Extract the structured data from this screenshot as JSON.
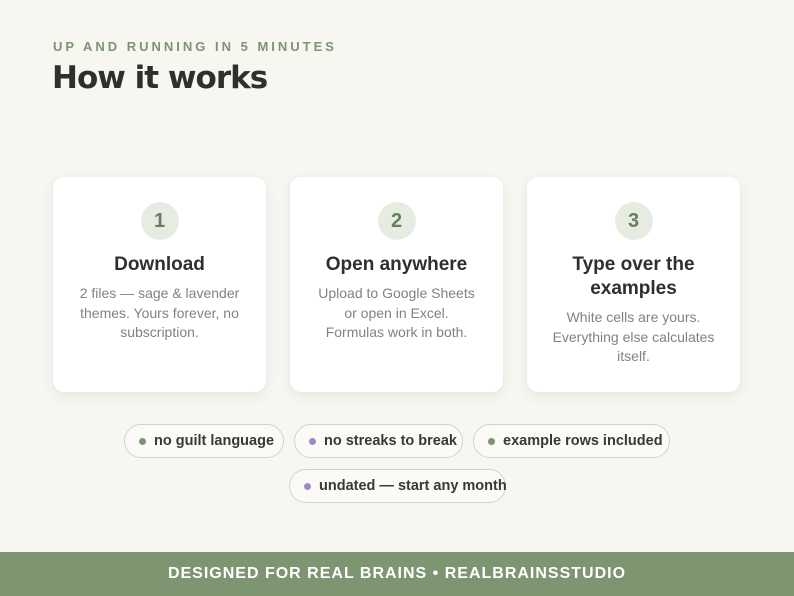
{
  "header": {
    "eyebrow": "UP AND RUNNING IN 5 MINUTES",
    "title": "How it works"
  },
  "steps": [
    {
      "number": "1",
      "title": "Download",
      "description": "2 files — sage & lavender themes. Yours forever, no subscription."
    },
    {
      "number": "2",
      "title": "Open anywhere",
      "description": "Upload to Google Sheets or open in Excel. Formulas work in both."
    },
    {
      "number": "3",
      "title": "Type over the examples",
      "description": "White cells are yours. Everything else calculates itself."
    }
  ],
  "features": [
    {
      "label": "no guilt language",
      "dot_color": "#7c9474"
    },
    {
      "label": "no streaks to break",
      "dot_color": "#9a8cc4"
    },
    {
      "label": "example rows included",
      "dot_color": "#7c9474"
    },
    {
      "label": "undated — start any month",
      "dot_color": "#9a8cc4"
    }
  ],
  "footer": {
    "text": "DESIGNED FOR REAL BRAINS • REALBRAINSSTUDIO"
  },
  "colors": {
    "background": "#f8f6f1",
    "accent": "#7c9474",
    "footer_bg": "#7e9572",
    "lavender": "#9a8cc4"
  }
}
